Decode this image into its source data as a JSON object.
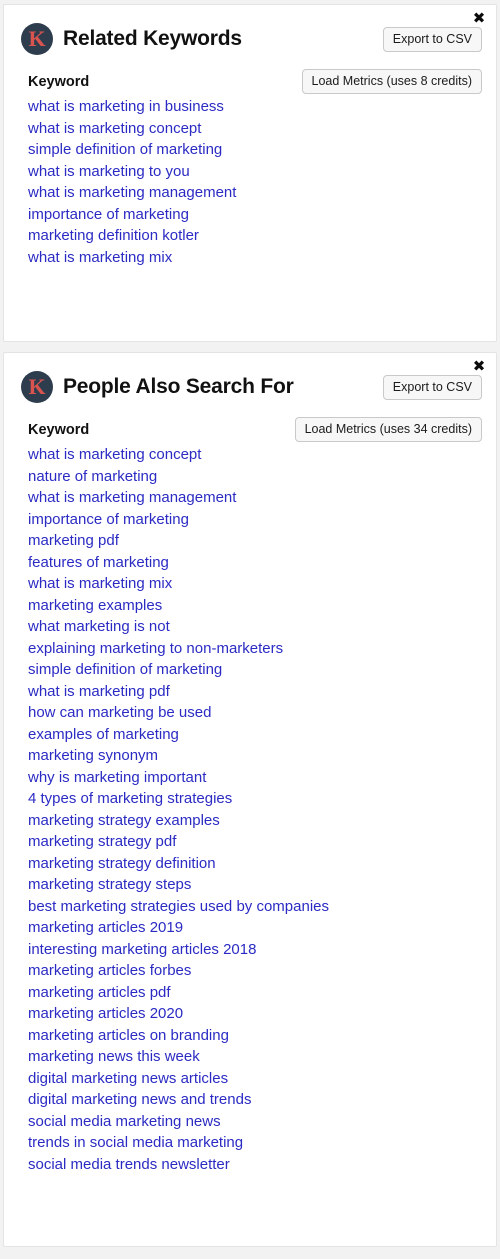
{
  "page": {
    "background_color": "#f2f2f3",
    "link_color": "#2b2bc4",
    "logo_circle_color": "#2e3d4e",
    "logo_letter_color": "#d9544e"
  },
  "panels": [
    {
      "id": "related-keywords",
      "logo_letter": "K",
      "title": "Related Keywords",
      "close_icon": "✖",
      "export_label": "Export to CSV",
      "load_metrics_label": "Load Metrics (uses 8 credits)",
      "column_header": "Keyword",
      "keywords": [
        "what is marketing in business",
        "what is marketing concept",
        "simple definition of marketing",
        "what is marketing to you",
        "what is marketing management",
        "importance of marketing",
        "marketing definition kotler",
        "what is marketing mix"
      ]
    },
    {
      "id": "people-also-search-for",
      "logo_letter": "K",
      "title": "People Also Search For",
      "close_icon": "✖",
      "export_label": "Export to CSV",
      "load_metrics_label": "Load Metrics (uses 34 credits)",
      "column_header": "Keyword",
      "keywords": [
        "what is marketing concept",
        "nature of marketing",
        "what is marketing management",
        "importance of marketing",
        "marketing pdf",
        "features of marketing",
        "what is marketing mix",
        "marketing examples",
        "what marketing is not",
        "explaining marketing to non-marketers",
        "simple definition of marketing",
        "what is marketing pdf",
        "how can marketing be used",
        "examples of marketing",
        "marketing synonym",
        "why is marketing important",
        "4 types of marketing strategies",
        "marketing strategy examples",
        "marketing strategy pdf",
        "marketing strategy definition",
        "marketing strategy steps",
        "best marketing strategies used by companies",
        "marketing articles 2019",
        "interesting marketing articles 2018",
        "marketing articles forbes",
        "marketing articles pdf",
        "marketing articles 2020",
        "marketing articles on branding",
        "marketing news this week",
        "digital marketing news articles",
        "digital marketing news and trends",
        "social media marketing news",
        "trends in social media marketing",
        "social media trends newsletter"
      ]
    }
  ]
}
